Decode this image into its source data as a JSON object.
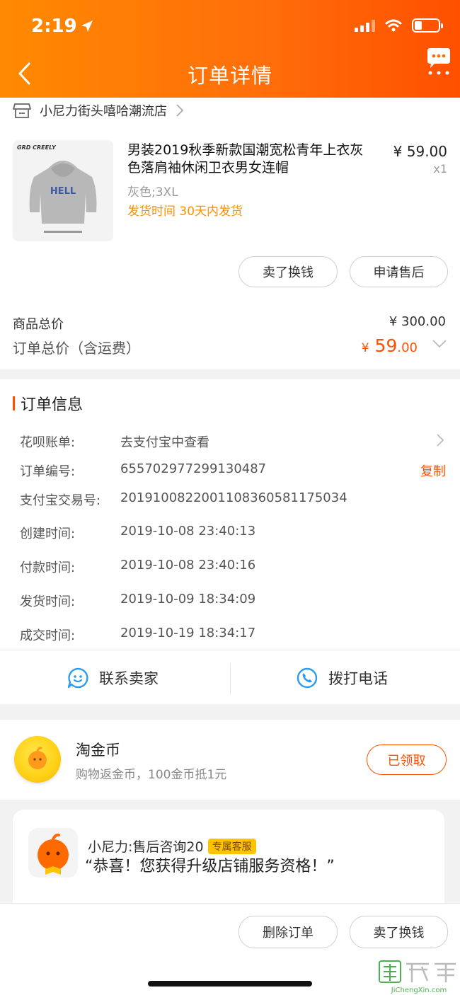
{
  "status_bar": {
    "time": "2:19"
  },
  "header": {
    "title": "订单详情"
  },
  "shop": {
    "name": "小尼力街头嘻哈潮流店"
  },
  "product": {
    "title": "男装2019秋季新款国潮宽松青年上衣灰色落肩袖休闲卫衣男女连帽",
    "sku": "灰色;3XL",
    "shipping_time": "发货时间  30天内发货",
    "price": "¥ 59.00",
    "quantity": "x1",
    "image_texts": {
      "brand": "GRD CREELY",
      "print": "HELL"
    }
  },
  "item_actions": {
    "sell_button": "卖了换钱",
    "after_sales_button": "申请售后"
  },
  "totals": {
    "goods_total_label": "商品总价",
    "goods_total_value": "¥ 300.00",
    "order_total_label": "订单总价（含运费）",
    "order_total_currency": "¥",
    "order_total_int": "59",
    "order_total_dec": ".00"
  },
  "order_info": {
    "title": "订单信息",
    "huabei": {
      "label": "花呗账单:",
      "value": "去支付宝中查看"
    },
    "order_no": {
      "label": "订单编号:",
      "value": "655702977299130487",
      "copy": "复制"
    },
    "alipay_no": {
      "label": "支付宝交易号:",
      "value": "2019100822001108360581175034"
    },
    "created": {
      "label": "创建时间:",
      "value": "2019-10-08 23:40:13"
    },
    "paid": {
      "label": "付款时间:",
      "value": "2019-10-08 23:40:16"
    },
    "shipped": {
      "label": "发货时间:",
      "value": "2019-10-09 18:34:09"
    },
    "completed": {
      "label": "成交时间:",
      "value": "2019-10-19 18:34:17"
    }
  },
  "contact": {
    "seller": "联系卖家",
    "phone": "拨打电话"
  },
  "coins": {
    "title": "淘金币",
    "subtitle": "购物返金币，100金币抵1元",
    "button": "已领取"
  },
  "service": {
    "name": "小尼力:售后咨询20",
    "badge": "专属客服",
    "message": "“恭喜！您获得升级店铺服务资格！”"
  },
  "bottom_actions": {
    "delete_order": "删除订单",
    "sell": "卖了换钱"
  },
  "watermark": {
    "text": "JiChengXin.com"
  },
  "colors": {
    "accent": "#ff5000",
    "header_start": "#ff8a00",
    "header_end": "#ff5000",
    "contact_blue": "#2c9cf0"
  }
}
